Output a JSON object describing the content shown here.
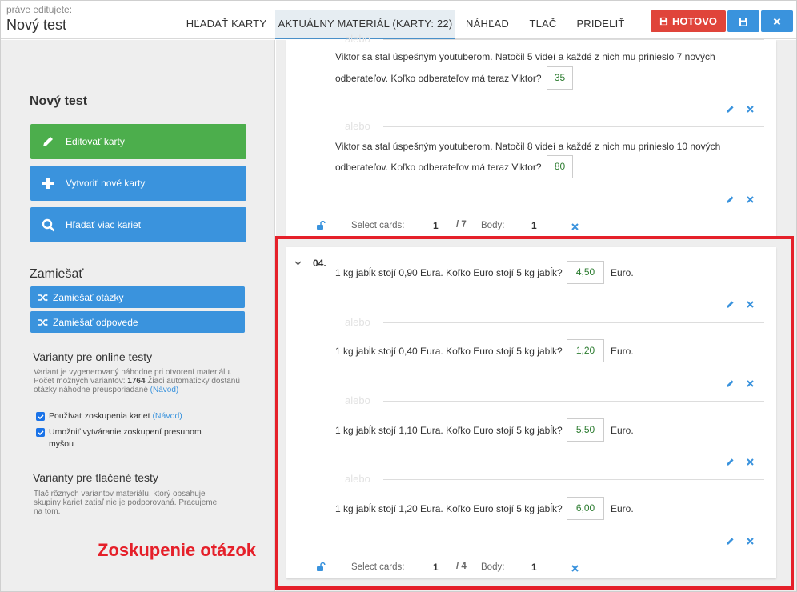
{
  "header": {
    "subtitle": "práve editujete:",
    "title": "Nový test",
    "tabs": [
      "HĽADAŤ KARTY",
      "AKTUÁLNY MATERIÁL (KARTY: 22)",
      "NÁHĽAD",
      "TLAČ",
      "PRIDELIŤ"
    ],
    "done_label": "HOTOVO"
  },
  "sidebar": {
    "heading": "Nový test",
    "buttons": [
      "Editovať karty",
      "Vytvoriť nové karty",
      "Hľadať viac kariet"
    ],
    "shuffle_title": "Zamiešať",
    "shuffle_questions": "Zamiešať otázky",
    "shuffle_answers": "Zamiešať odpovede",
    "online_title": "Varianty pre online testy",
    "online_text_1": "Variant je vygenerovaný náhodne pri otvorení materiálu. Počet možných variantov:",
    "online_count": "1764",
    "online_text_2": "Žiaci automaticky dostanú otázky náhodne preusporiadané",
    "guide_link": "(Návod)",
    "check_1": "Používať zoskupenia kariet",
    "check_1_link": "(Návod)",
    "check_2": "Umožniť vytváranie zoskupení presunom myšou",
    "print_title": "Varianty pre tlačené testy",
    "print_text": "Tlač rôznych variantov materiálu, ktorý obsahuje skupiny kariet zatiaľ nie je podporovaná. Pracujeme na tom."
  },
  "alebo": "alebo",
  "group1": {
    "questions": [
      {
        "line1": "Viktor sa stal úspešným youtuberom. Natočil 5 videí a každé z nich mu prinieslo 7 nových",
        "line2": "odberateľov. Koľko odberateľov má teraz Viktor?",
        "answer": "35"
      },
      {
        "line1": "Viktor sa stal úspešným youtuberom. Natočil 8 videí a každé z nich mu prinieslo 10 nových",
        "line2": "odberateľov. Koľko odberateľov má teraz Viktor?",
        "answer": "80"
      }
    ],
    "footer": {
      "select_label": "Select cards:",
      "selected": "1",
      "total": "/ 7",
      "points_label": "Body:",
      "points": "1"
    }
  },
  "group2": {
    "number": "04.",
    "unit": "Euro.",
    "questions": [
      {
        "text": "1 kg jabĺk stojí 0,90 Eura. Koľko Euro stojí 5 kg jabĺk?",
        "answer": "4,50"
      },
      {
        "text": "1 kg jabĺk stojí 0,40 Eura. Koľko Euro stojí 5 kg jabĺk?",
        "answer": "1,20"
      },
      {
        "text": "1 kg jabĺk stojí 1,10 Eura. Koľko Euro stojí 5 kg jabĺk?",
        "answer": "5,50"
      },
      {
        "text": "1 kg jabĺk stojí 1,20 Eura. Koľko Euro stojí 5 kg jabĺk?",
        "answer": "6,00"
      }
    ],
    "footer": {
      "select_label": "Select cards:",
      "selected": "1",
      "total": "/ 4",
      "points_label": "Body:",
      "points": "1"
    }
  },
  "annotation": "Zoskupenie otázok",
  "colors": {
    "accent": "#3a93dd",
    "danger": "#e0443a",
    "success": "#4cae4c",
    "highlight": "#e5202a"
  }
}
